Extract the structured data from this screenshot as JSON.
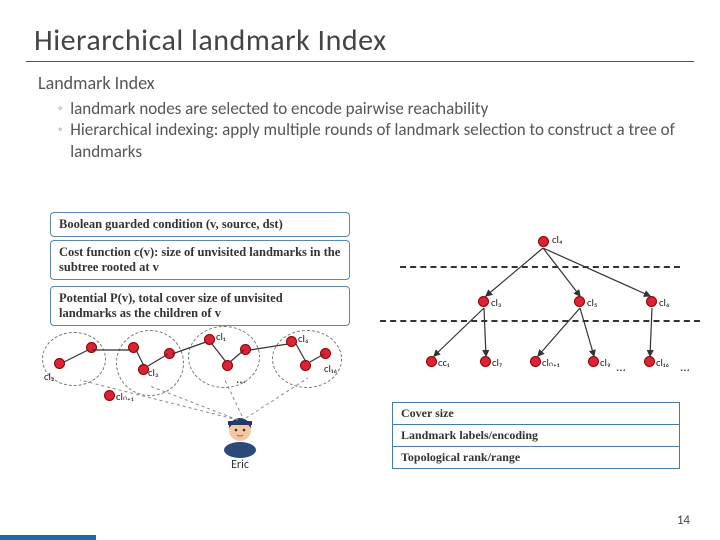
{
  "title": "Hierarchical landmark Index",
  "subheading": "Landmark Index",
  "bullets": [
    "landmark nodes are selected to encode pairwise reachability",
    "Hierarchical indexing:  apply multiple rounds of landmark selection to construct a tree of landmarks"
  ],
  "boxes": {
    "cond": "Boolean guarded condition (v, source, dst)",
    "cost": "Cost function c(v):  size of unvisited landmarks in the subtree rooted at v",
    "pot": "Potential P(v), total cover size of unvisited landmarks as the children of v"
  },
  "labels": {
    "cl4": "cl₄",
    "cl3": "cl₃",
    "cl5": "cl₅",
    "cl6_r": "cl₆",
    "cc1": "cc₁",
    "cl7": "cl₇",
    "cln1_r": "clₙ₊₁",
    "cl9": "cl₉",
    "cl16_r": "cl₁₆",
    "cl2": "cl₂",
    "cl3_l": "cl₃",
    "cl1": "cl₁",
    "cl6_l": "cl₆",
    "cl16_l": "cl₁₆",
    "cln1_l": "clₙ₊₁",
    "dots": "...",
    "eric": "Eric"
  },
  "table_rows": [
    "Cover size",
    "Landmark labels/encoding",
    "Topological rank/range"
  ],
  "page_number": "14",
  "chart_data": {
    "type": "diagram",
    "title": "Hierarchical landmark Index",
    "tree": {
      "root": "cl4",
      "children": {
        "cl4": [
          "cl3",
          "cl5",
          "cl6"
        ],
        "cl3": [
          "cc1",
          "cl7"
        ],
        "cl5": [
          "cln+1",
          "cl9"
        ],
        "cl6": [
          "cl16"
        ]
      }
    },
    "left_clusters": [
      "cl2",
      "cl3",
      "cl1",
      "cl6",
      "cl16",
      "cln+1"
    ],
    "properties": [
      "Cover size",
      "Landmark labels/encoding",
      "Topological rank/range"
    ]
  }
}
